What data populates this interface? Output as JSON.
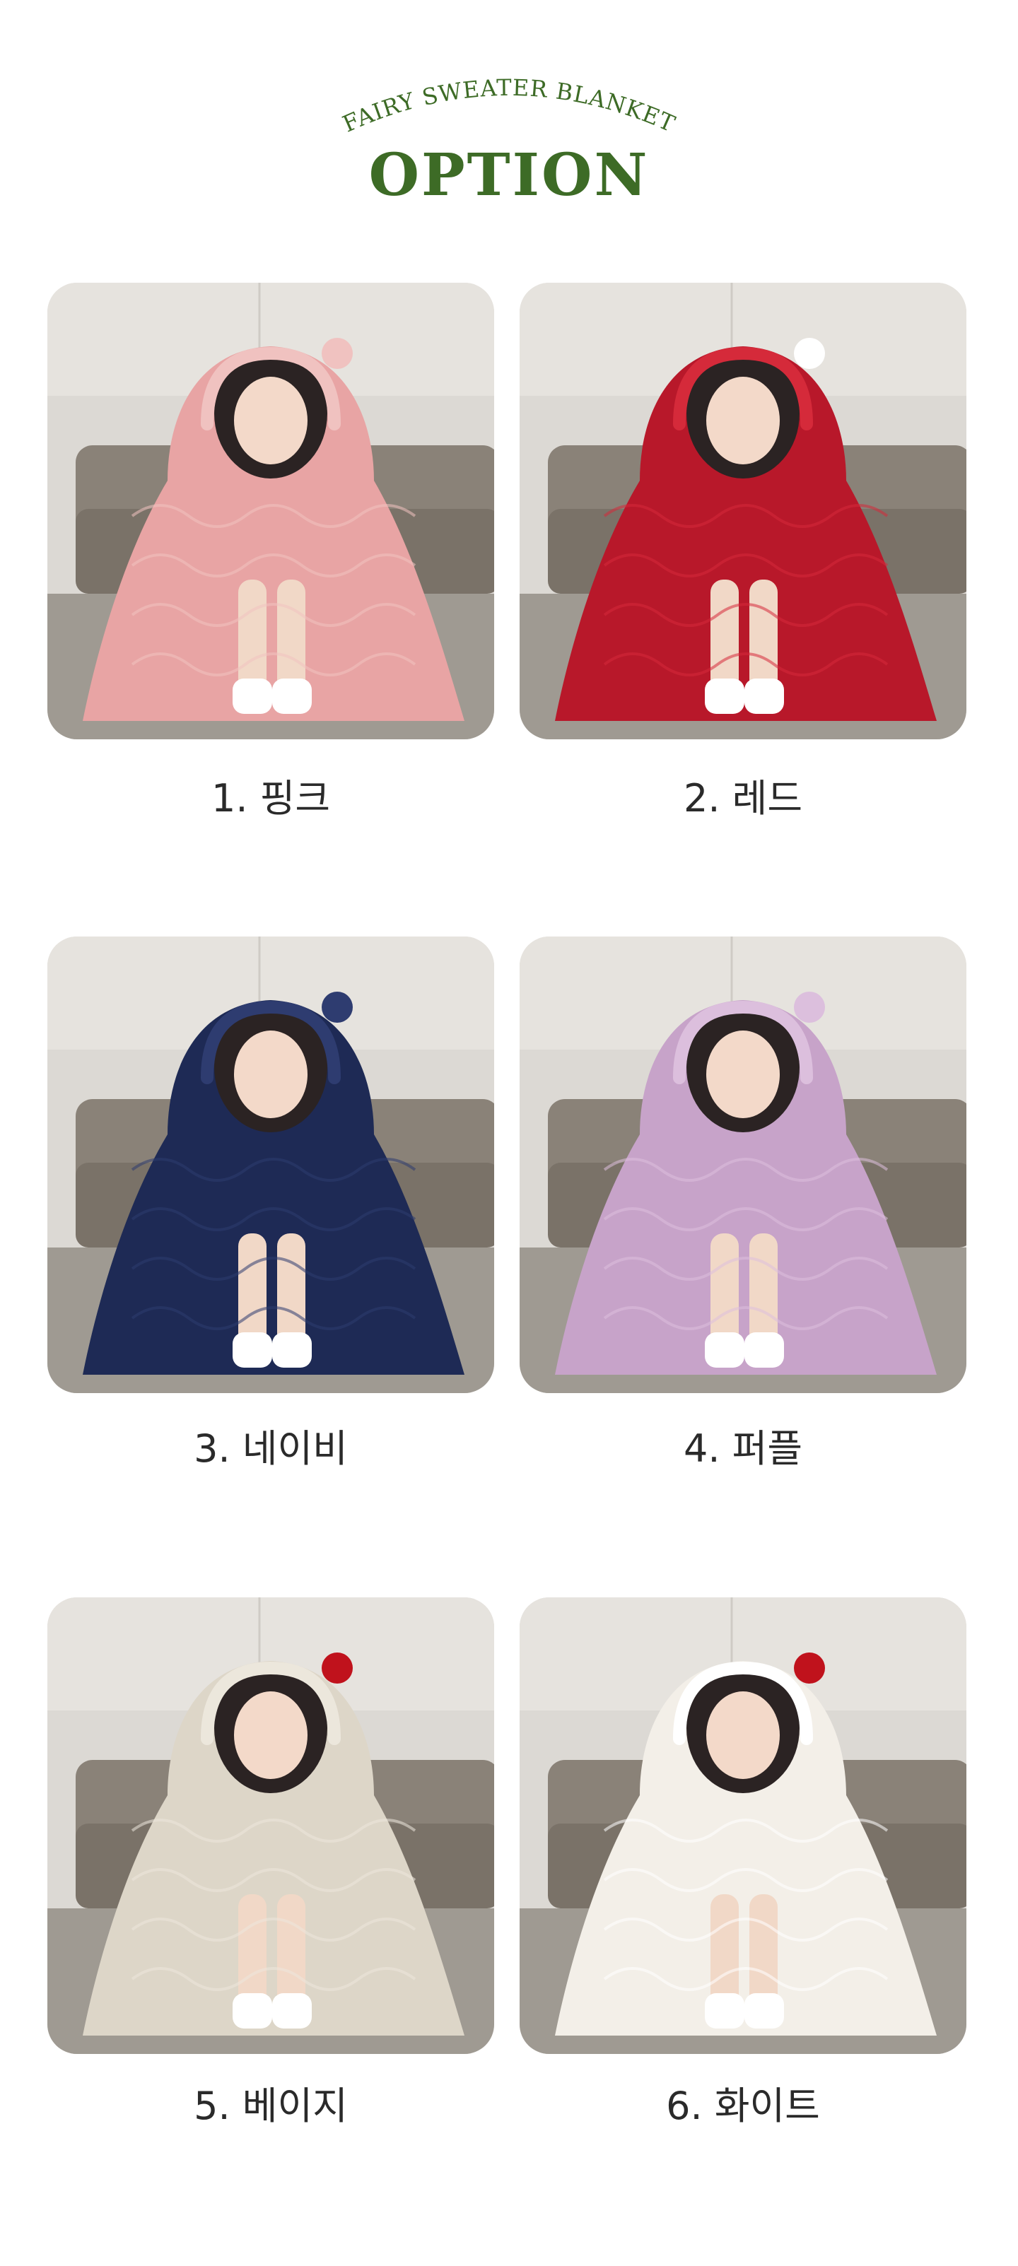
{
  "header": {
    "subtitle": "FAIRY SWEATER BLANKET",
    "title": "OPTION",
    "title_color": "#3d6b26"
  },
  "options": [
    {
      "label": "1. 핑크",
      "blanket_color": "#e8a4a4",
      "accent": "#f0c2c0"
    },
    {
      "label": "2. 레드",
      "blanket_color": "#b8182a",
      "accent": "#d52a3a"
    },
    {
      "label": "3. 네이비",
      "blanket_color": "#1e2a55",
      "accent": "#2e3c70"
    },
    {
      "label": "4. 퍼플",
      "blanket_color": "#c7a3c9",
      "accent": "#dcbfdd"
    },
    {
      "label": "5. 베이지",
      "blanket_color": "#ddd6c8",
      "accent": "#ece7dc"
    },
    {
      "label": "6. 화이트",
      "blanket_color": "#f3efe8",
      "accent": "#ffffff"
    }
  ]
}
